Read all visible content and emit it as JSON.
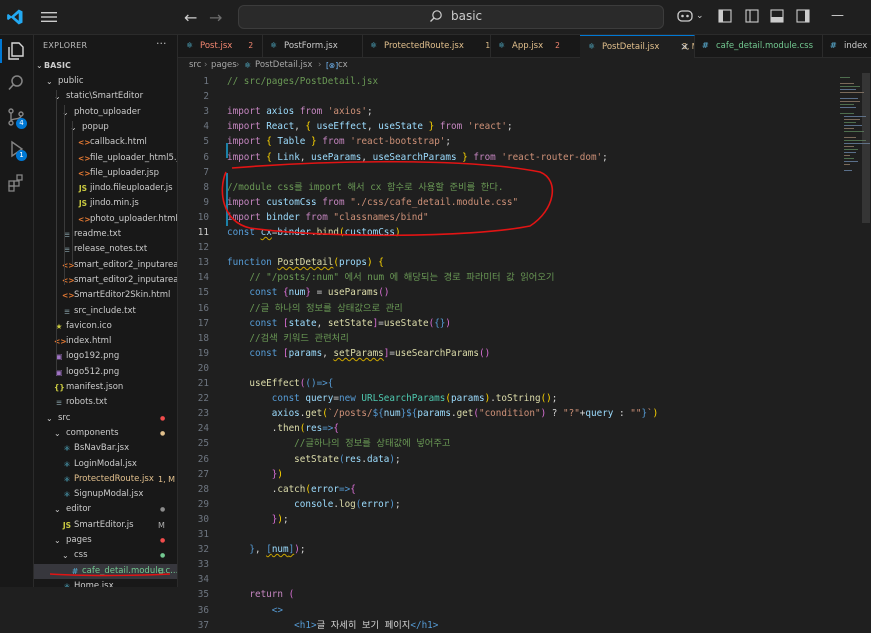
{
  "titlebar": {
    "search_text": "basic"
  },
  "activity": {
    "scm_badge": "4",
    "run_badge": "1"
  },
  "explorer": {
    "title": "EXPLORER",
    "more": "···",
    "root": "BASIC",
    "items": [
      {
        "name": "public",
        "kind": "folder",
        "level": 1,
        "open": true
      },
      {
        "name": "static\\SmartEditor",
        "kind": "folder",
        "level": 2,
        "open": true
      },
      {
        "name": "photo_uploader",
        "kind": "folder",
        "level": 3,
        "open": true
      },
      {
        "name": "popup",
        "kind": "folder",
        "level": 4,
        "open": true
      },
      {
        "name": "callback.html",
        "kind": "html",
        "level": 5
      },
      {
        "name": "file_uploader_html5.jsp",
        "kind": "html",
        "level": 5
      },
      {
        "name": "file_uploader.jsp",
        "kind": "html",
        "level": 5
      },
      {
        "name": "jindo.fileuploader.js",
        "kind": "js",
        "level": 5
      },
      {
        "name": "jindo.min.js",
        "kind": "js",
        "level": 5
      },
      {
        "name": "photo_uploader.html",
        "kind": "html",
        "level": 5
      },
      {
        "name": "readme.txt",
        "kind": "txt",
        "level": 3
      },
      {
        "name": "release_notes.txt",
        "kind": "txt",
        "level": 3
      },
      {
        "name": "smart_editor2_inputarea_i...",
        "kind": "html",
        "level": 3
      },
      {
        "name": "smart_editor2_inputarea.ht...",
        "kind": "html",
        "level": 3
      },
      {
        "name": "SmartEditor2Skin.html",
        "kind": "html",
        "level": 3
      },
      {
        "name": "src_include.txt",
        "kind": "txt",
        "level": 3
      },
      {
        "name": "favicon.ico",
        "kind": "ico",
        "level": 2
      },
      {
        "name": "index.html",
        "kind": "html",
        "level": 2
      },
      {
        "name": "logo192.png",
        "kind": "img",
        "level": 2
      },
      {
        "name": "logo512.png",
        "kind": "img",
        "level": 2
      },
      {
        "name": "manifest.json",
        "kind": "json",
        "level": 2
      },
      {
        "name": "robots.txt",
        "kind": "txt",
        "level": 2
      },
      {
        "name": "src",
        "kind": "folder",
        "level": 1,
        "open": true,
        "dot": "red"
      },
      {
        "name": "components",
        "kind": "folder",
        "level": 2,
        "open": true,
        "dot": "orange"
      },
      {
        "name": "BsNavBar.jsx",
        "kind": "jsx",
        "level": 3
      },
      {
        "name": "LoginModal.jsx",
        "kind": "jsx",
        "level": 3
      },
      {
        "name": "ProtectedRoute.jsx",
        "kind": "jsx",
        "level": 3,
        "status": "1, M",
        "status_color": "#e2c08d",
        "name_color": "#e2c08d"
      },
      {
        "name": "SignupModal.jsx",
        "kind": "jsx",
        "level": 3
      },
      {
        "name": "editor",
        "kind": "folder",
        "level": 2,
        "open": true,
        "dot": "grey"
      },
      {
        "name": "SmartEditor.js",
        "kind": "js",
        "level": 3,
        "status": "M",
        "status_color": "#b0b0b0"
      },
      {
        "name": "pages",
        "kind": "folder",
        "level": 2,
        "open": true,
        "dot": "red"
      },
      {
        "name": "css",
        "kind": "folder",
        "level": 3,
        "open": true,
        "dot": "green"
      },
      {
        "name": "cafe_detail.module.c...",
        "kind": "css",
        "level": 4,
        "status": "U",
        "status_color": "#73c991",
        "name_color": "#73c991",
        "selected": true
      },
      {
        "name": "Home.jsx",
        "kind": "jsx",
        "level": 3
      }
    ]
  },
  "tabs": [
    {
      "name": "Post.jsx",
      "badge": "2",
      "badge_color": "#f48771",
      "name_color": "#f48771",
      "icon": "react"
    },
    {
      "name": "PostForm.jsx",
      "badge": "",
      "name_color": "#cccccc",
      "icon": "react"
    },
    {
      "name": "ProtectedRoute.jsx",
      "badge": "1, M",
      "badge_color": "#e2c08d",
      "name_color": "#e2c08d",
      "icon": "react"
    },
    {
      "name": "App.jsx",
      "badge": "2",
      "badge_color": "#f48771",
      "name_color": "#e2c08d",
      "icon": "react"
    },
    {
      "name": "PostDetail.jsx",
      "badge": "3, M",
      "badge_color": "#e2c08d",
      "name_color": "#e2c08d",
      "icon": "react",
      "active": true,
      "close": "×"
    },
    {
      "name": "cafe_detail.module.css",
      "badge": "U",
      "badge_color": "#73c991",
      "name_color": "#73c991",
      "icon": "css"
    },
    {
      "name": "index",
      "badge": "",
      "name_color": "#cccccc",
      "icon": "css"
    }
  ],
  "breadcrumb": [
    "src",
    "pages",
    "PostDetail.jsx",
    "cx"
  ],
  "editor": {
    "current_line": 11,
    "lines": [
      {
        "n": 1,
        "html": "<span class='c'>// src/pages/PostDetail.jsx</span>"
      },
      {
        "n": 2,
        "html": ""
      },
      {
        "n": 3,
        "html": "<span class='k'>import</span> <span class='v'>axios</span> <span class='k'>from</span> <span class='s'>'axios'</span><span class='p'>;</span>"
      },
      {
        "n": 4,
        "html": "<span class='k'>import</span> <span class='v'>React</span><span class='p'>, </span><span class='y'>{</span> <span class='v'>useEffect</span><span class='p'>, </span><span class='v'>useState</span> <span class='y'>}</span> <span class='k'>from</span> <span class='s'>'react'</span><span class='p'>;</span>"
      },
      {
        "n": 5,
        "html": "<span class='k'>import</span> <span class='y'>{</span> <span class='v'>Table</span> <span class='y'>}</span> <span class='k'>from</span> <span class='s'>'react-bootstrap'</span><span class='p'>;</span>"
      },
      {
        "n": 6,
        "html": "<span class='k'>import</span> <span class='y'>{</span> <span class='v'>Link</span><span class='p'>, </span><span class='v'>useParams</span><span class='p'>, </span><span class='v'>useSearchParams</span> <span class='y'>}</span> <span class='k'>from</span> <span class='s'>'react-router-dom'</span><span class='p'>;</span>"
      },
      {
        "n": 7,
        "html": ""
      },
      {
        "n": 8,
        "html": "<span class='c'>//module css를 import 해서 cx 함수로 사용할 준비를 한다.</span>"
      },
      {
        "n": 9,
        "html": "<span class='k'>import</span> <span class='v'>customCss</span> <span class='k'>from</span> <span class='s'>\"./css/cafe_detail.module.css\"</span>"
      },
      {
        "n": 10,
        "html": "<span class='k'>import</span> <span class='v'>binder</span> <span class='k'>from</span> <span class='s'>\"classnames/bind\"</span>"
      },
      {
        "n": 11,
        "html": "<span class='d'>const</span> <span class='v' style='text-decoration:underline wavy #cca700;'>cx</span><span class='p'>=</span><span class='v'>binder</span><span class='p'>.</span><span class='f'>bind</span><span class='y'>(</span><span class='v'>customCss</span><span class='y'>)</span>"
      },
      {
        "n": 12,
        "html": ""
      },
      {
        "n": 13,
        "html": "<span class='d'>function</span> <span class='f' style='text-decoration:underline wavy #cca700;'>PostDetail</span><span class='y'>(</span><span class='v'>props</span><span class='y'>)</span> <span class='y'>{</span>"
      },
      {
        "n": 14,
        "html": "    <span class='c'>// \"/posts/:num\" 에서 num 에 해당되는 경로 파라미터 값 읽어오기</span>"
      },
      {
        "n": 15,
        "html": "    <span class='d'>const</span> <span class='m'>{</span><span class='v'>num</span><span class='m'>}</span> <span class='p'>=</span> <span class='f'>useParams</span><span class='m'>()</span>"
      },
      {
        "n": 16,
        "html": "    <span class='c'>//글 하나의 정보를 상태값으로 관리</span>"
      },
      {
        "n": 17,
        "html": "    <span class='d'>const</span> <span class='m'>[</span><span class='v'>state</span><span class='p'>, </span><span class='f'>setState</span><span class='m'>]</span><span class='p'>=</span><span class='f'>useState</span><span class='m'>(</span><span class='d'>{}</span><span class='m'>)</span>"
      },
      {
        "n": 18,
        "html": "    <span class='c'>//검색 키워드 관련처리</span>"
      },
      {
        "n": 19,
        "html": "    <span class='d'>const</span> <span class='m'>[</span><span class='v'>params</span><span class='p'>, </span><span class='f' style='text-decoration:underline wavy #cca700;'>setParams</span><span class='m'>]</span><span class='p'>=</span><span class='f'>useSearchParams</span><span class='m'>()</span>"
      },
      {
        "n": 20,
        "html": ""
      },
      {
        "n": 21,
        "html": "    <span class='f'>useEffect</span><span class='m'>(</span><span class='d'>()</span><span class='d'>=&gt;</span><span class='d'>{</span>"
      },
      {
        "n": 22,
        "html": "        <span class='d'>const</span> <span class='v'>query</span><span class='p'>=</span><span class='d'>new</span> <span class='t'>URLSearchParams</span><span class='y'>(</span><span class='v'>params</span><span class='y'>)</span><span class='p'>.</span><span class='f'>toString</span><span class='y'>()</span><span class='p'>;</span>"
      },
      {
        "n": 23,
        "html": "        <span class='v'>axios</span><span class='p'>.</span><span class='f'>get</span><span class='y'>(</span><span class='s'>`/posts/</span><span class='d'>${</span><span class='v'>num</span><span class='d'>}${</span><span class='v'>params</span><span class='p'>.</span><span class='f'>get</span><span class='m'>(</span><span class='s'>\"condition\"</span><span class='m'>)</span> <span class='p'>?</span> <span class='s'>\"?\"</span><span class='p'>+</span><span class='v'>query</span> <span class='p'>:</span> <span class='s'>\"\"</span><span class='d'>}</span><span class='s'>`</span><span class='y'>)</span>"
      },
      {
        "n": 24,
        "html": "        <span class='p'>.</span><span class='f'>then</span><span class='y'>(</span><span class='v'>res</span><span class='d'>=&gt;</span><span class='m'>{</span>"
      },
      {
        "n": 25,
        "html": "            <span class='c'>//글하나의 정보를 상태값에 넣어주고</span>"
      },
      {
        "n": 26,
        "html": "            <span class='f'>setState</span><span class='d'>(</span><span class='v'>res</span><span class='p'>.</span><span class='v'>data</span><span class='d'>)</span><span class='p'>;</span>"
      },
      {
        "n": 27,
        "html": "        <span class='m'>}</span><span class='y'>)</span>"
      },
      {
        "n": 28,
        "html": "        <span class='p'>.</span><span class='f'>catch</span><span class='y'>(</span><span class='v'>error</span><span class='d'>=&gt;</span><span class='m'>{</span>"
      },
      {
        "n": 29,
        "html": "            <span class='v'>console</span><span class='p'>.</span><span class='f'>log</span><span class='d'>(</span><span class='v'>error</span><span class='d'>)</span><span class='p'>;</span>"
      },
      {
        "n": 30,
        "html": "        <span class='m'>}</span><span class='y'>)</span><span class='p'>;</span>"
      },
      {
        "n": 31,
        "html": ""
      },
      {
        "n": 32,
        "html": "    <span class='d'>}</span><span class='p'>, </span><span class='d' style='text-decoration:underline wavy #cca700;'>[</span><span class='v' style='text-decoration:underline wavy #cca700;'>num</span><span class='d' style='text-decoration:underline wavy #cca700;'>]</span><span class='m'>)</span><span class='p'>;</span>"
      },
      {
        "n": 33,
        "html": ""
      },
      {
        "n": 34,
        "html": ""
      },
      {
        "n": 35,
        "html": "    <span class='k'>return</span> <span class='m'>(</span>"
      },
      {
        "n": 36,
        "html": "        <span class='d'>&lt;&gt;</span>"
      },
      {
        "n": 37,
        "html": "            <span class='d'>&lt;</span><span class='d'>h1</span><span class='d'>&gt;</span><span class='p'>글 자세히 보기 페이지</span><span class='d'>&lt;/</span><span class='d'>h1</span><span class='d'>&gt;</span>"
      }
    ]
  }
}
